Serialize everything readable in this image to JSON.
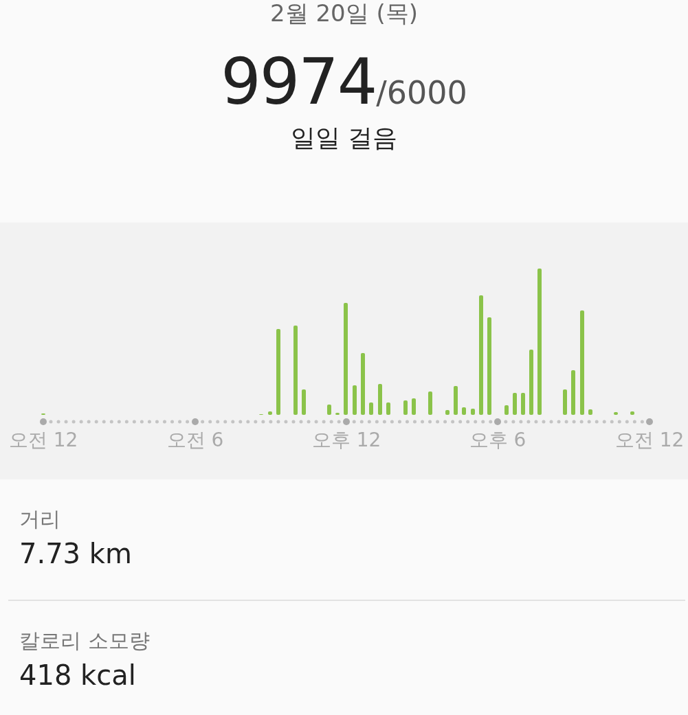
{
  "header": {
    "date": "2월 20일 (목)",
    "steps": "9974",
    "goal": "/6000",
    "caption": "일일 걸음"
  },
  "chart": {
    "axis_labels": [
      "오전 12",
      "오전 6",
      "오후 12",
      "오후 6",
      "오전 12"
    ]
  },
  "stats": [
    {
      "label": "거리",
      "value": "7.73 km"
    },
    {
      "label": "칼로리 소모량",
      "value": "418 kcal"
    }
  ]
}
